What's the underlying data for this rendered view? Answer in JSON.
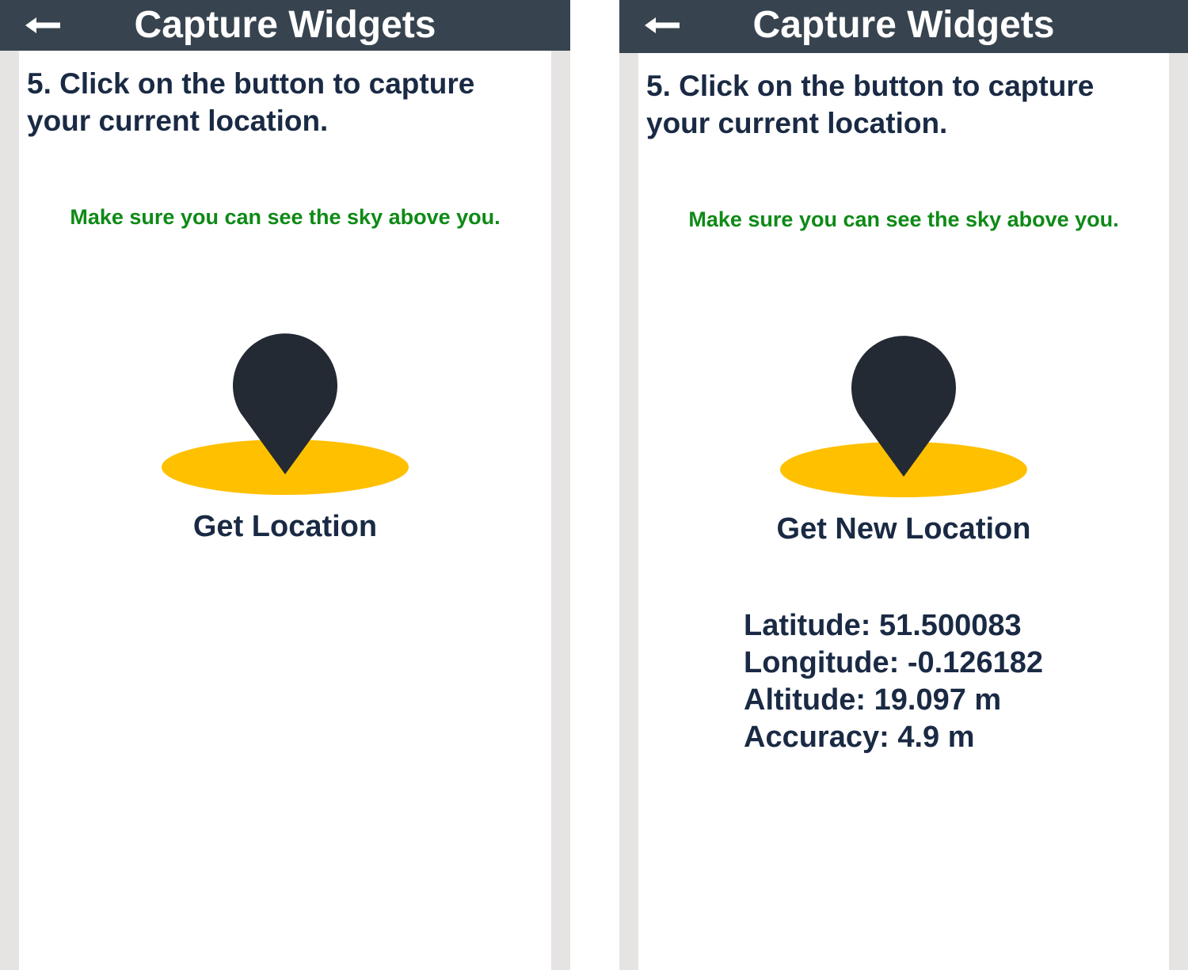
{
  "screens": [
    {
      "header": {
        "title": "Capture Widgets"
      },
      "question": "5. Click on the button to capture your current location.",
      "hint": "Make sure you can see the sky above you.",
      "button_label": "Get Location"
    },
    {
      "header": {
        "title": "Capture Widgets"
      },
      "question": "5. Click on the button to capture your current location.",
      "hint": "Make sure you can see the sky above you.",
      "button_label": "Get New Location",
      "location": {
        "latitude": "Latitude: 51.500083",
        "longitude": "Longitude: -0.126182",
        "altitude": "Altitude: 19.097 m",
        "accuracy": "Accuracy: 4.9 m"
      }
    }
  ],
  "icons": {
    "back": "arrow-left-icon",
    "pin": "map-pin-icon",
    "ground": "ground-ellipse-icon"
  },
  "colors": {
    "header_bg": "#37444f",
    "header_text": "#ffffff",
    "text_primary": "#1a2a44",
    "hint_green": "#0e8a16",
    "pin": "#232a33",
    "ground": "#ffc000",
    "side_gutter": "#e5e4e2"
  }
}
